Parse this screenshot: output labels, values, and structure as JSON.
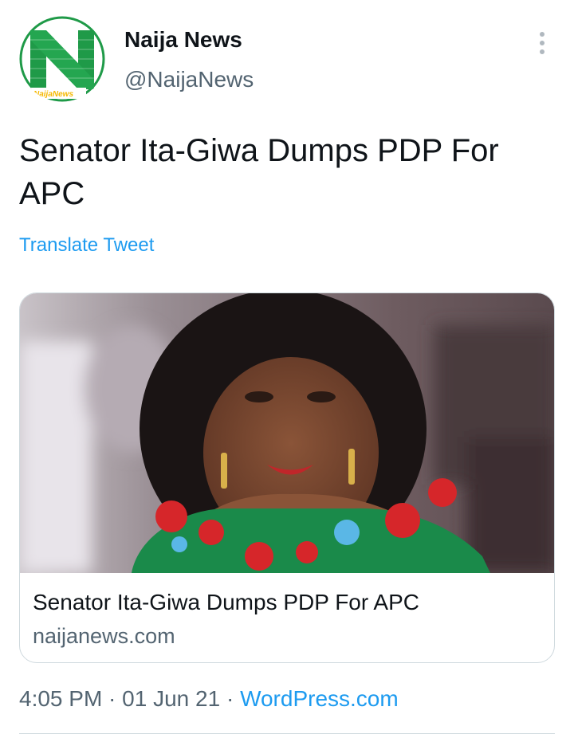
{
  "tweet": {
    "author": {
      "display_name": "Naija News",
      "handle": "@NaijaNews",
      "avatar_wordmark": "NaijaNews"
    },
    "text": "Senator Ita-Giwa Dumps PDP For APC",
    "translate_label": "Translate Tweet",
    "more_icon": "more-vertical-icon",
    "card": {
      "title": "Senator Ita-Giwa Dumps PDP For APC",
      "domain": "naijanews.com"
    },
    "meta": {
      "time": "4:05 PM",
      "separator": " · ",
      "date": "01 Jun 21",
      "source": "WordPress.com"
    }
  },
  "colors": {
    "text": "#0f1419",
    "secondary": "#536471",
    "link": "#1d9bf0",
    "border": "#cfd9de",
    "brand_green": "#1f9a48"
  }
}
